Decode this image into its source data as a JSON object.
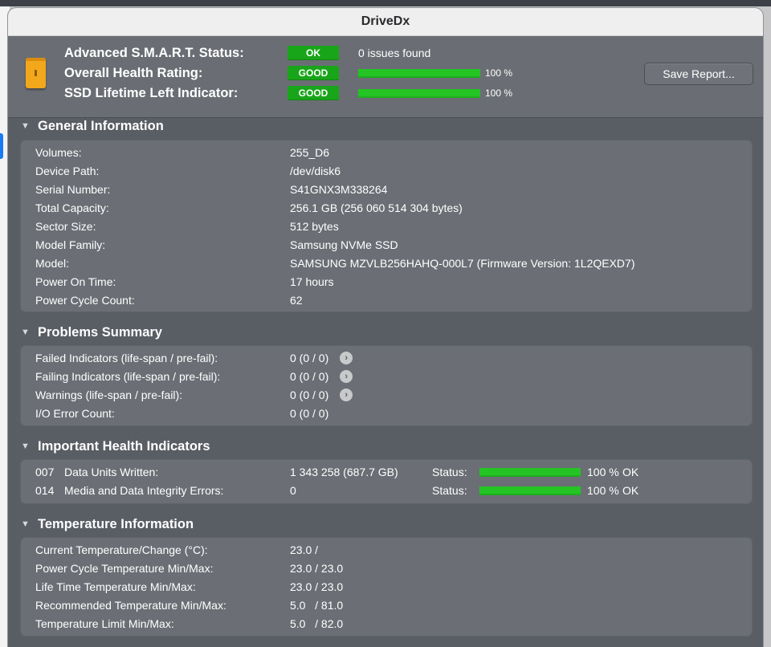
{
  "app": {
    "title": "DriveDx"
  },
  "header": {
    "smart_label": "Advanced S.M.A.R.T. Status:",
    "smart_badge": "OK",
    "smart_issues": "0 issues found",
    "health_label": "Overall Health Rating:",
    "health_badge": "GOOD",
    "health_percent_text": "100 %",
    "health_percent": 100,
    "lifetime_label": "SSD Lifetime Left Indicator:",
    "lifetime_badge": "GOOD",
    "lifetime_percent_text": "100 %",
    "lifetime_percent": 100,
    "save_button": "Save Report...",
    "accent_green": "#24c424"
  },
  "general": {
    "title": "General Information",
    "rows": [
      {
        "label": "Volumes:",
        "value": "255_D6"
      },
      {
        "label": "Device Path:",
        "value": "/dev/disk6"
      },
      {
        "label": "Serial Number:",
        "value": "S41GNX3M338264"
      },
      {
        "label": "Total Capacity:",
        "value": "256.1 GB (256 060 514 304 bytes)"
      },
      {
        "label": "Sector Size:",
        "value": "512 bytes"
      },
      {
        "label": "Model Family:",
        "value": "Samsung NVMe SSD"
      },
      {
        "label": "Model:",
        "value": "SAMSUNG MZVLB256HAHQ-000L7  (Firmware Version: 1L2QEXD7)"
      },
      {
        "label": "Power On Time:",
        "value": "17 hours"
      },
      {
        "label": "Power Cycle Count:",
        "value": "62"
      }
    ]
  },
  "problems": {
    "title": "Problems Summary",
    "rows": [
      {
        "label": "Failed Indicators (life-span / pre-fail):",
        "value": "0  (0 / 0)"
      },
      {
        "label": "Failing Indicators (life-span / pre-fail):",
        "value": "0  (0 / 0)"
      },
      {
        "label": "Warnings (life-span / pre-fail):",
        "value": "0  (0 / 0)"
      },
      {
        "label": "I/O Error Count:",
        "value": "0  (0 / 0)"
      }
    ]
  },
  "health": {
    "title": "Important Health Indicators",
    "rows": [
      {
        "code": "007",
        "label": "Data Units Written:",
        "value": "1 343 258 (687.7 GB)",
        "status_label": "Status:",
        "percent": 100,
        "percent_text": "100 %",
        "result": "OK"
      },
      {
        "code": "014",
        "label": "Media and Data Integrity Errors:",
        "value": "0",
        "status_label": "Status:",
        "percent": 100,
        "percent_text": "100 %",
        "result": "OK"
      }
    ]
  },
  "temperature": {
    "title": "Temperature Information",
    "rows": [
      {
        "label": "Current Temperature/Change (°C):",
        "value": "23.0 /"
      },
      {
        "label": "Power Cycle Temperature Min/Max:",
        "value": "23.0 / 23.0"
      },
      {
        "label": "Life Time Temperature Min/Max:",
        "value": "23.0 / 23.0"
      },
      {
        "label": "Recommended Temperature Min/Max:",
        "value": "5.0   / 81.0"
      },
      {
        "label": "Temperature Limit Min/Max:",
        "value": "5.0   / 82.0"
      }
    ]
  }
}
